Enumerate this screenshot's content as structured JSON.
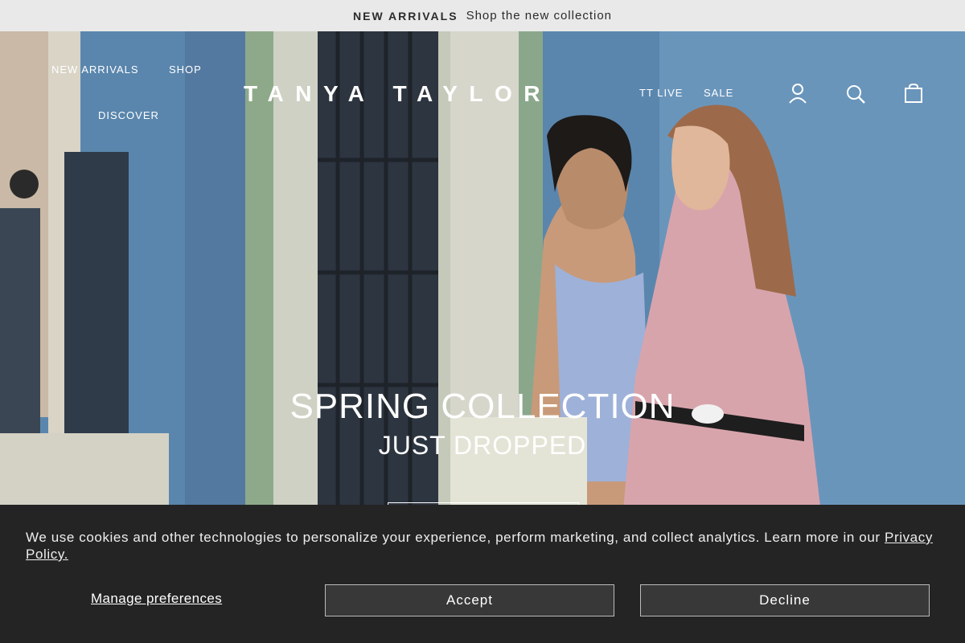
{
  "announcement": {
    "bold": "NEW ARRIVALS",
    "text": "Shop the new collection"
  },
  "nav": {
    "new_arrivals": "NEW ARRIVALS",
    "shop": "SHOP",
    "discover": "DISCOVER",
    "tt_live": "TT LIVE",
    "sale": "SALE",
    "logo": "TANYA TAYLOR",
    "icons": [
      "account-icon",
      "search-icon",
      "bag-icon"
    ]
  },
  "hero": {
    "headline": "SPRING COLLECTION",
    "subheadline": "JUST DROPPED"
  },
  "cookie": {
    "message": "We use cookies and other technologies to personalize your experience, perform marketing, and collect analytics. Learn more in our",
    "link": "Privacy Policy.",
    "manage": "Manage preferences",
    "accept": "Accept",
    "decline": "Decline"
  },
  "colors": {
    "announcement_bg": "#e9e9e9",
    "cookie_bg": "#242424",
    "wall_blue": "#5a86ad",
    "dress_pink": "#dfa4ae"
  }
}
